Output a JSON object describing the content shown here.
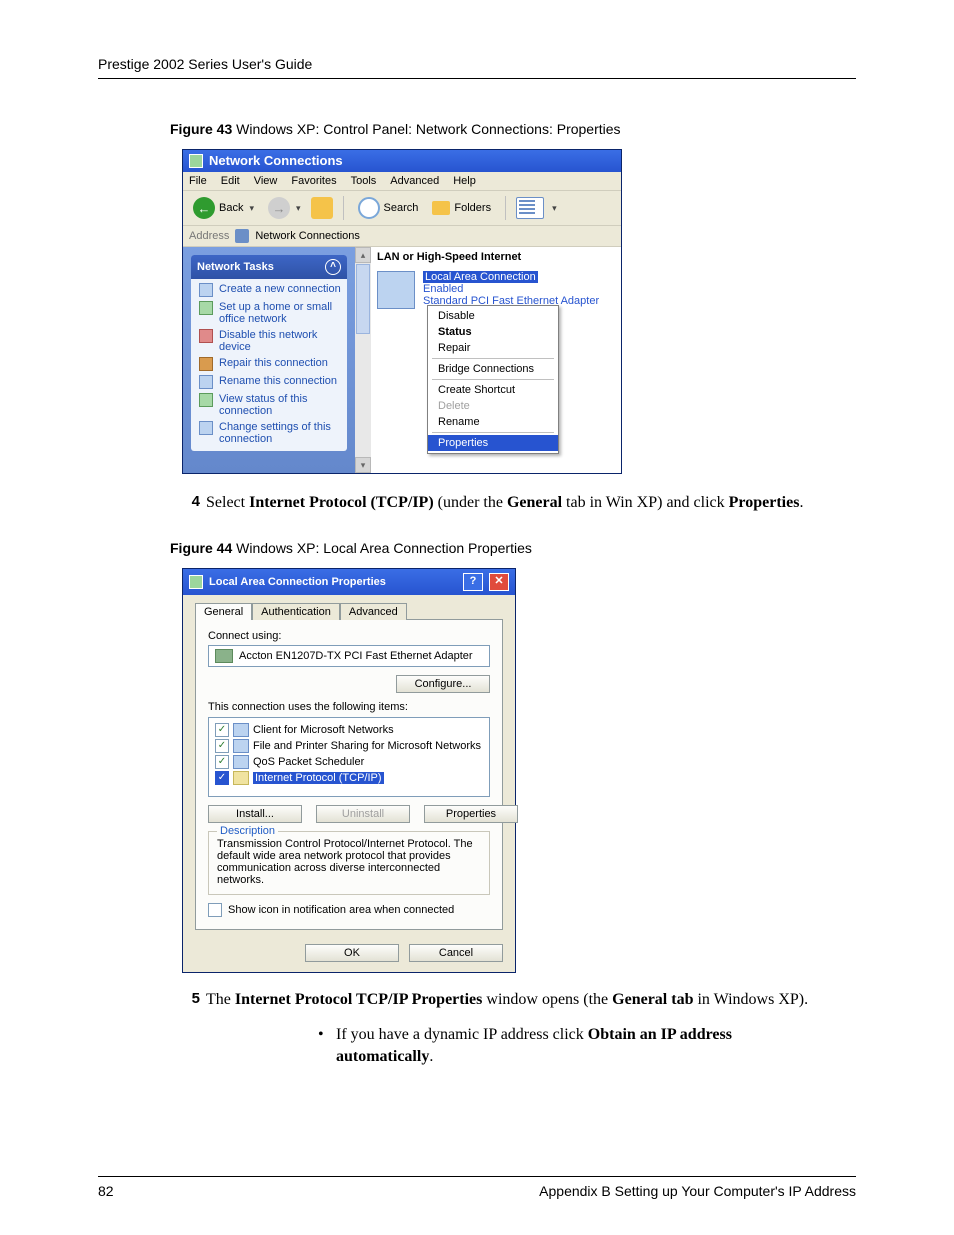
{
  "doc": {
    "running_header": "Prestige 2002 Series User's Guide",
    "page_number": "82",
    "appendix": "Appendix B Setting up Your Computer's IP Address"
  },
  "fig43": {
    "caption_label": "Figure 43",
    "caption_text": "   Windows XP: Control Panel: Network Connections: Properties",
    "title": "Network Connections",
    "menus": [
      "File",
      "Edit",
      "View",
      "Favorites",
      "Tools",
      "Advanced",
      "Help"
    ],
    "toolbar": {
      "back": "Back",
      "search": "Search",
      "folders": "Folders"
    },
    "address_label": "Address",
    "address_value": "Network Connections",
    "tasks_header": "Network Tasks",
    "tasks": [
      "Create a new connection",
      "Set up a home or small office network",
      "Disable this network device",
      "Repair this connection",
      "Rename this connection",
      "View status of this connection",
      "Change settings of this connection"
    ],
    "group_header": "LAN or High-Speed Internet",
    "conn": {
      "name": "Local Area Connection",
      "status": "Enabled",
      "adapter": "Standard PCI Fast Ethernet Adapter"
    },
    "context_menu": {
      "disable": "Disable",
      "status": "Status",
      "repair": "Repair",
      "bridge": "Bridge Connections",
      "shortcut": "Create Shortcut",
      "delete": "Delete",
      "rename": "Rename",
      "properties": "Properties"
    }
  },
  "step4": {
    "num": "4",
    "pre": "Select ",
    "b1": "Internet Protocol (TCP/IP)",
    "mid1": " (under the ",
    "b2": "General",
    "mid2": " tab in Win XP) and click ",
    "b3": "Properties",
    "post": "."
  },
  "fig44": {
    "caption_label": "Figure 44",
    "caption_text": "   Windows XP: Local Area Connection Properties",
    "title": "Local Area Connection Properties",
    "tabs": [
      "General",
      "Authentication",
      "Advanced"
    ],
    "connect_using_label": "Connect using:",
    "adapter": "Accton EN1207D-TX PCI Fast Ethernet Adapter",
    "configure": "Configure...",
    "uses_items_label": "This connection uses the following items:",
    "items": [
      "Client for Microsoft Networks",
      "File and Printer Sharing for Microsoft Networks",
      "QoS Packet Scheduler",
      "Internet Protocol (TCP/IP)"
    ],
    "install": "Install...",
    "uninstall": "Uninstall",
    "properties": "Properties",
    "description_label": "Description",
    "description_text": "Transmission Control Protocol/Internet Protocol. The default wide area network protocol that provides communication across diverse interconnected networks.",
    "notify_label": "Show icon in notification area when connected",
    "ok": "OK",
    "cancel": "Cancel"
  },
  "step5": {
    "num": "5",
    "pre": "The ",
    "b1": "Internet Protocol TCP/IP Properties",
    "mid1": " window opens (the ",
    "b2": "General tab",
    "post": " in Windows XP)."
  },
  "bullet1": {
    "pre": "If you have a dynamic IP address click ",
    "b1": "Obtain an IP address automatically",
    "post": "."
  }
}
